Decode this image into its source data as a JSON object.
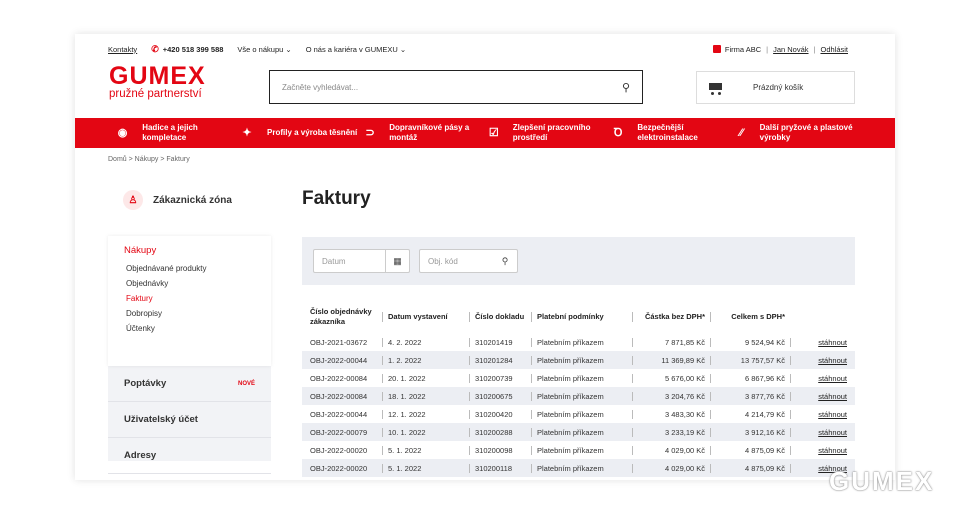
{
  "topbar": {
    "contacts": "Kontakty",
    "phone": "+420 518 399 588",
    "menu1": "Vše o nákupu",
    "menu2": "O nás a kariéra v GUMEXU",
    "firm": "Firma ABC",
    "user": "Jan Novák",
    "logout": "Odhlásit"
  },
  "logo": {
    "brand": "GUMEX",
    "tagline": "pružné partnerství"
  },
  "search": {
    "placeholder": "Začněte vyhledávat..."
  },
  "cart": {
    "label": "Prázdný košík"
  },
  "nav": [
    {
      "icon": "hose-icon",
      "label": "Hadice a jejich kompletace"
    },
    {
      "icon": "profile-icon",
      "label": "Profily a výroba těsnění"
    },
    {
      "icon": "belt-icon",
      "label": "Dopravníkové pásy a montáž"
    },
    {
      "icon": "workspace-icon",
      "label": "Zlepšení pracovního prostředí"
    },
    {
      "icon": "electric-icon",
      "label": "Bezpečnější elektroinstalace"
    },
    {
      "icon": "rubber-icon",
      "label": "Další pryžové a plastové výrobky"
    }
  ],
  "breadcrumb": "Domů  >  Nákupy  >  Faktury",
  "sidebar": {
    "zone": "Zákaznická zóna",
    "purchases": "Nákupy",
    "sub": [
      "Objednávané produkty",
      "Objednávky",
      "Faktury",
      "Dobropisy",
      "Účtenky"
    ],
    "inquiries": "Poptávky",
    "new_badge": "NOVÉ",
    "account": "Uživatelský účet",
    "addresses": "Adresy"
  },
  "main": {
    "title": "Faktury",
    "filter_date": "Datum",
    "filter_code": "Obj. kód"
  },
  "table": {
    "headers": [
      "Číslo objednávky zákazníka",
      "Datum vystavení",
      "Číslo dokladu",
      "Platební podmínky",
      "Částka bez DPH*",
      "Celkem s DPH*"
    ],
    "download": "stáhnout",
    "rows": [
      [
        "OBJ-2021-03672",
        "4. 2. 2022",
        "310201419",
        "Platebním příkazem",
        "7 871,85 Kč",
        "9 524,94 Kč"
      ],
      [
        "OBJ-2022-00044",
        "1. 2. 2022",
        "310201284",
        "Platebním příkazem",
        "11 369,89 Kč",
        "13 757,57 Kč"
      ],
      [
        "OBJ-2022-00084",
        "20. 1. 2022",
        "310200739",
        "Platebním příkazem",
        "5 676,00 Kč",
        "6 867,96 Kč"
      ],
      [
        "OBJ-2022-00084",
        "18. 1. 2022",
        "310200675",
        "Platebním příkazem",
        "3 204,76 Kč",
        "3 877,76 Kč"
      ],
      [
        "OBJ-2022-00044",
        "12. 1. 2022",
        "310200420",
        "Platebním příkazem",
        "3 483,30 Kč",
        "4 214,79 Kč"
      ],
      [
        "OBJ-2022-00079",
        "10. 1. 2022",
        "310200288",
        "Platebním příkazem",
        "3 233,19 Kč",
        "3 912,16 Kč"
      ],
      [
        "OBJ-2022-00020",
        "5. 1. 2022",
        "310200098",
        "Platebním příkazem",
        "4 029,00 Kč",
        "4 875,09 Kč"
      ],
      [
        "OBJ-2022-00020",
        "5. 1. 2022",
        "310200118",
        "Platebním příkazem",
        "4 029,00 Kč",
        "4 875,09 Kč"
      ]
    ]
  },
  "watermark": "GUMEX",
  "colors": {
    "brand_red": "#e30613",
    "filter_bg": "#eceef3"
  }
}
